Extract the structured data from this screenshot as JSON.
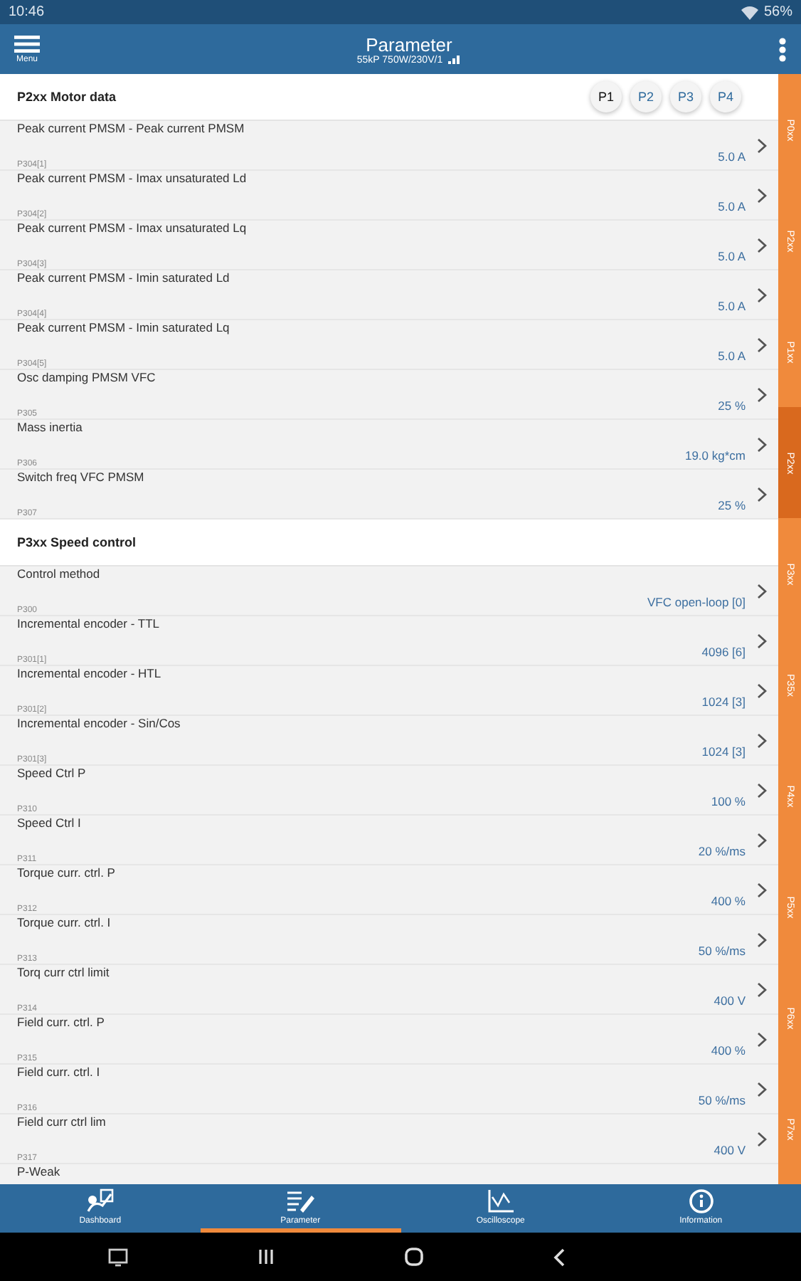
{
  "status_bar": {
    "time": "10:46",
    "battery": "56%"
  },
  "header": {
    "menu_label": "Menu",
    "title": "Parameter",
    "subtitle": "55kP 750W/230V/1"
  },
  "sections": [
    {
      "title": "P2xx Motor data",
      "sets": [
        {
          "label": "P1",
          "selected": true
        },
        {
          "label": "P2",
          "selected": false
        },
        {
          "label": "P3",
          "selected": false
        },
        {
          "label": "P4",
          "selected": false
        }
      ],
      "rows": [
        {
          "name": "Peak current PMSM - Peak current PMSM",
          "code": "P304[1]",
          "value": "5.0 A"
        },
        {
          "name": "Peak current PMSM - Imax unsaturated Ld",
          "code": "P304[2]",
          "value": "5.0 A"
        },
        {
          "name": "Peak current PMSM - Imax unsaturated Lq",
          "code": "P304[3]",
          "value": "5.0 A"
        },
        {
          "name": "Peak current PMSM - Imin saturated Ld",
          "code": "P304[4]",
          "value": "5.0 A"
        },
        {
          "name": "Peak current PMSM - Imin saturated Lq",
          "code": "P304[5]",
          "value": "5.0 A"
        },
        {
          "name": "Osc damping PMSM VFC",
          "code": "P305",
          "value": "25 %"
        },
        {
          "name": "Mass inertia",
          "code": "P306",
          "value": "19.0 kg*cm"
        },
        {
          "name": "Switch freq VFC PMSM",
          "code": "P307",
          "value": "25 %"
        }
      ]
    },
    {
      "title": "P3xx Speed control",
      "rows": [
        {
          "name": "Control method",
          "code": "P300",
          "value": "VFC open-loop [0]"
        },
        {
          "name": "Incremental encoder - TTL",
          "code": "P301[1]",
          "value": "4096 [6]"
        },
        {
          "name": "Incremental encoder - HTL",
          "code": "P301[2]",
          "value": "1024 [3]"
        },
        {
          "name": "Incremental encoder - Sin/Cos",
          "code": "P301[3]",
          "value": "1024 [3]"
        },
        {
          "name": "Speed Ctrl P",
          "code": "P310",
          "value": "100 %"
        },
        {
          "name": "Speed Ctrl I",
          "code": "P311",
          "value": "20 %/ms"
        },
        {
          "name": "Torque curr. ctrl. P",
          "code": "P312",
          "value": "400 %"
        },
        {
          "name": "Torque curr. ctrl. I",
          "code": "P313",
          "value": "50 %/ms"
        },
        {
          "name": "Torq curr ctrl limit",
          "code": "P314",
          "value": "400 V"
        },
        {
          "name": "Field curr. ctrl. P",
          "code": "P315",
          "value": "400 %"
        },
        {
          "name": "Field curr. ctrl. I",
          "code": "P316",
          "value": "50 %/ms"
        },
        {
          "name": "Field curr ctrl lim",
          "code": "P317",
          "value": "400 V"
        },
        {
          "name": "P-Weak"
        }
      ]
    }
  ],
  "side_tabs": [
    {
      "label": "P0xx",
      "selected": false
    },
    {
      "label": "P2xx",
      "selected": false
    },
    {
      "label": "P1xx",
      "selected": false
    },
    {
      "label": "P2xx",
      "selected": true
    },
    {
      "label": "P3xx",
      "selected": false
    },
    {
      "label": "P35x",
      "selected": false
    },
    {
      "label": "P4xx",
      "selected": false
    },
    {
      "label": "P5xx",
      "selected": false
    },
    {
      "label": "P6xx",
      "selected": false
    },
    {
      "label": "P7xx",
      "selected": false
    }
  ],
  "bottom_nav": [
    {
      "label": "Dashboard",
      "selected": false
    },
    {
      "label": "Parameter",
      "selected": true
    },
    {
      "label": "Oscilloscope",
      "selected": false
    },
    {
      "label": "Information",
      "selected": false
    }
  ]
}
